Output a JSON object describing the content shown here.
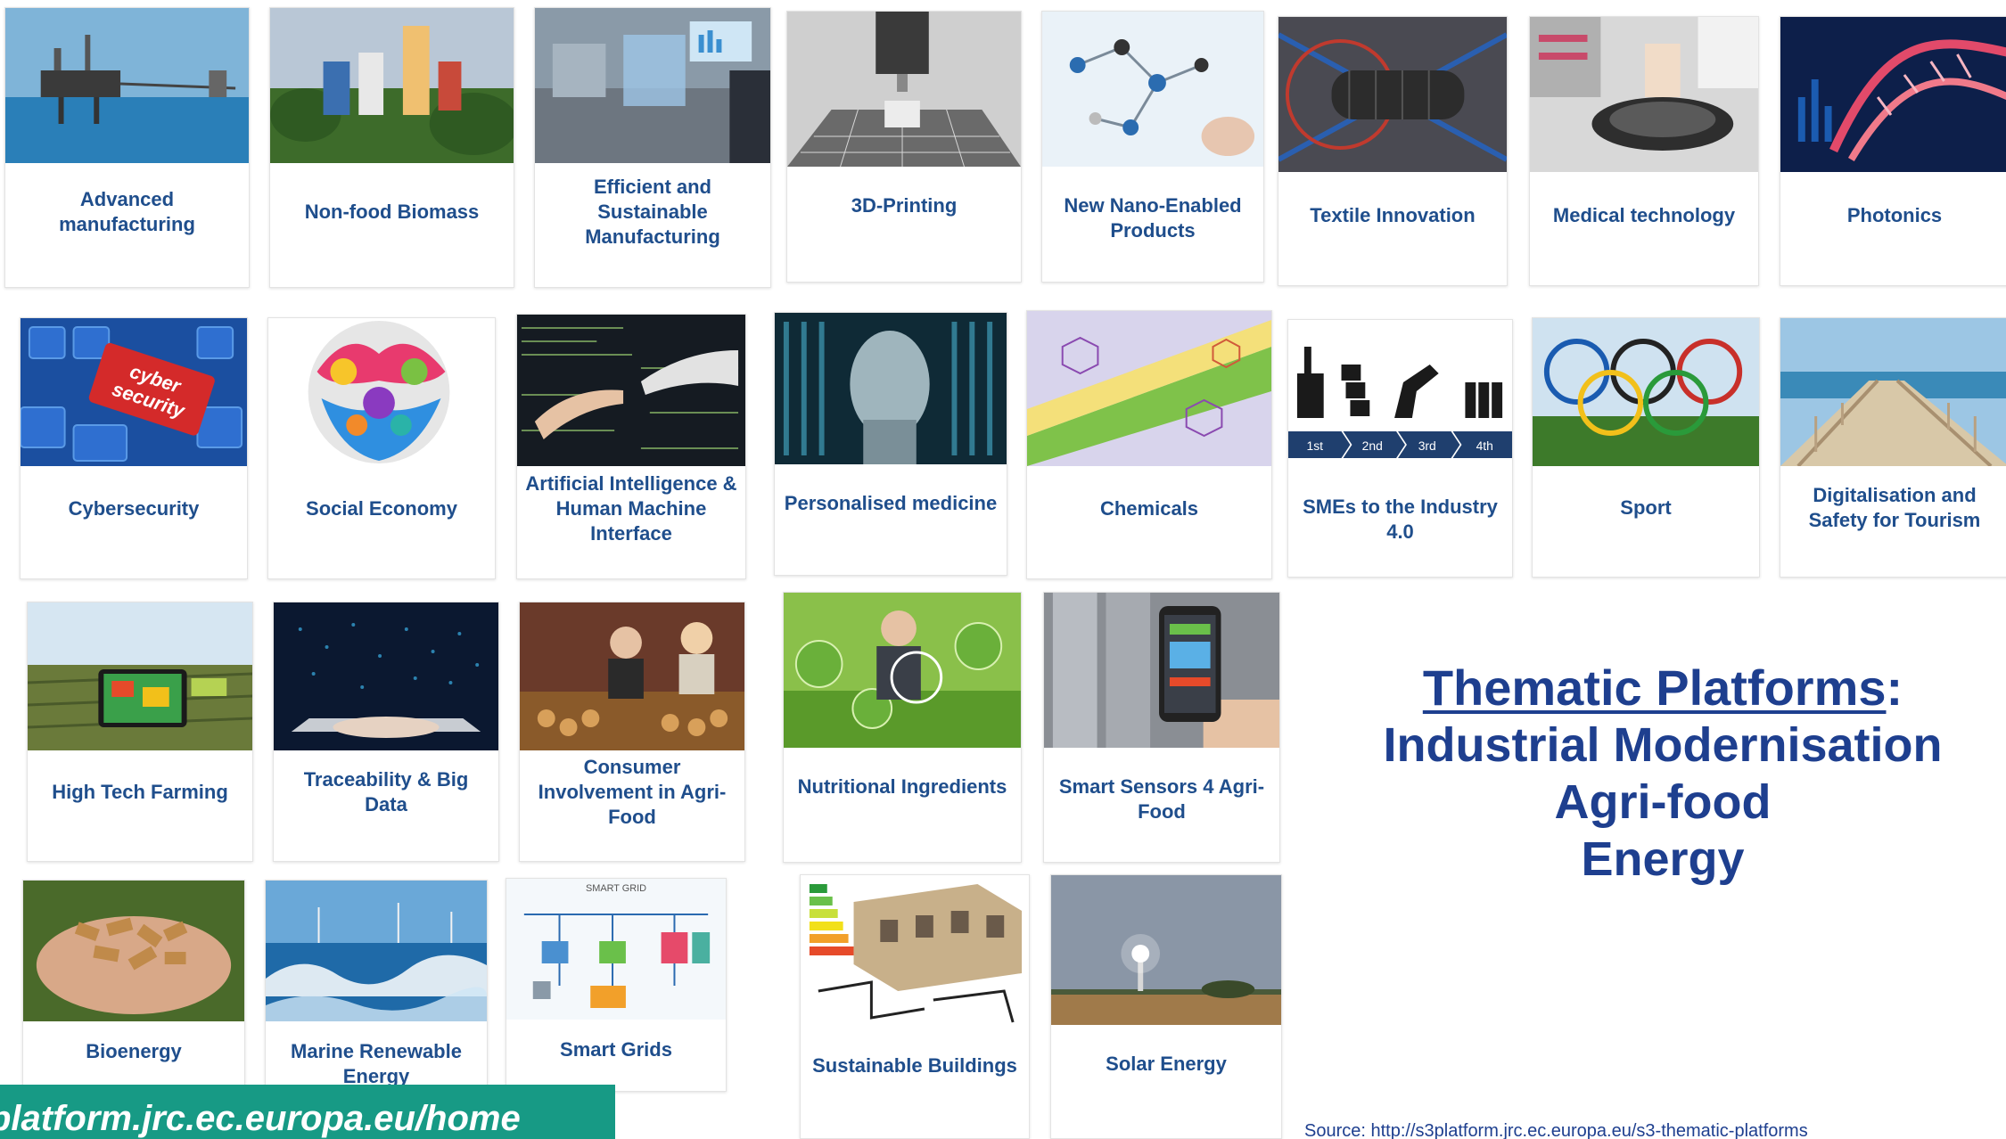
{
  "title": {
    "link_text": "Thematic Platforms",
    "colon": ":",
    "lines": [
      "Industrial Modernisation",
      "Agri-food",
      "Energy"
    ]
  },
  "source_text": "Source: http://s3platform.jrc.ec.europa.eu/s3-thematic-platforms",
  "url_banner_text": "platform.jrc.ec.europa.eu/home",
  "tiles": {
    "industrial": [
      "Advanced manufacturing",
      "Non-food Biomass",
      "Efficient and Sustainable Manufacturing",
      "3D-Printing",
      "New Nano-Enabled Products",
      "Textile Innovation",
      "Medical technology",
      "Photonics",
      "Cybersecurity",
      "Social Economy",
      "Artificial Intelligence & Human Machine Interface",
      "Personalised medicine",
      "Chemicals",
      "SMEs to the Industry 4.0",
      "Sport",
      "Digitalisation and Safety for Tourism"
    ],
    "agrifood": [
      "High Tech Farming",
      "Traceability & Big Data",
      "Consumer Involvement in Agri-Food",
      "Nutritional Ingredients",
      "Smart Sensors 4 Agri-Food"
    ],
    "energy": [
      "Bioenergy",
      "Marine Renewable Energy",
      "Smart Grids",
      "Sustainable Buildings",
      "Solar Energy"
    ]
  },
  "image_text": {
    "cyber_key_word1": "cyber",
    "cyber_key_word2": "security",
    "sme_steps": [
      "1st",
      "2nd",
      "3rd",
      "4th"
    ],
    "smart_grid_caption": "SMART GRID"
  },
  "colors": {
    "label_blue": "#1f4e8c",
    "title_blue": "#1e3f8f",
    "banner_teal": "#179a85"
  }
}
